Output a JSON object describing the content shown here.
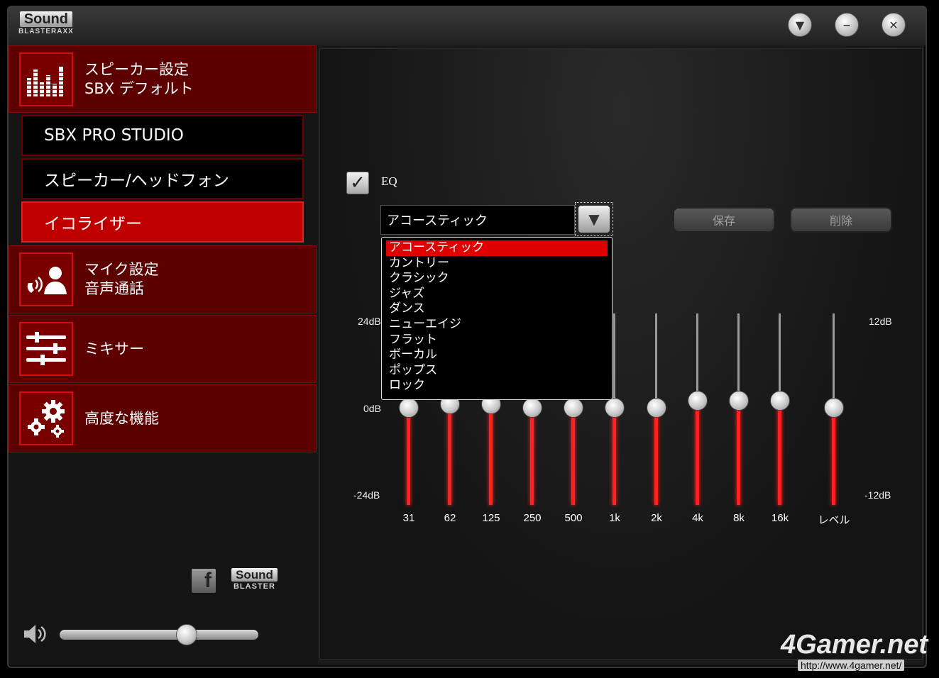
{
  "app": {
    "logo_line1": "Sound",
    "logo_line2": "BLASTERAXX",
    "window_buttons": [
      "dropdown",
      "minimize",
      "close"
    ]
  },
  "sidebar": {
    "categories": [
      {
        "icon": "equalizer-bars-icon",
        "line1": "スピーカー設定",
        "line2": "SBX デフォルト"
      },
      {
        "icon": "voice-chat-icon",
        "line1": "マイク設定",
        "line2": "音声通話"
      },
      {
        "icon": "mixer-sliders-icon",
        "line1": "ミキサー",
        "line2": ""
      },
      {
        "icon": "gears-icon",
        "line1": "高度な機能",
        "line2": ""
      }
    ],
    "subitems": [
      {
        "label": "SBX PRO STUDIO",
        "active": false
      },
      {
        "label": "スピーカー/ヘッドフォン",
        "active": false
      },
      {
        "label": "イコライザー",
        "active": true
      }
    ],
    "footer": {
      "facebook_letter": "f",
      "brand_line1": "Sound",
      "brand_line2": "BLASTER",
      "volume_level": 0.64
    }
  },
  "equalizer": {
    "checkbox_label": "EQ",
    "checked": true,
    "preset_value": "アコースティック",
    "save_label": "保存",
    "delete_label": "削除",
    "left_scale": {
      "top": "24dB",
      "mid": "0dB",
      "bottom": "-24dB"
    },
    "right_scale": {
      "top": "12dB",
      "bottom": "-12dB"
    },
    "bands": [
      {
        "label": "31",
        "level_db": 0
      },
      {
        "label": "62",
        "level_db": 1
      },
      {
        "label": "125",
        "level_db": 1
      },
      {
        "label": "250",
        "level_db": 0
      },
      {
        "label": "500",
        "level_db": 0
      },
      {
        "label": "1k",
        "level_db": 0
      },
      {
        "label": "2k",
        "level_db": 0
      },
      {
        "label": "4k",
        "level_db": 2
      },
      {
        "label": "8k",
        "level_db": 2
      },
      {
        "label": "16k",
        "level_db": 2
      }
    ],
    "level_label": "レベル",
    "level_db": 0,
    "dropdown_options": [
      "アコースティック",
      "カントリー",
      "クラシック",
      "ジャズ",
      "ダンス",
      "ニューエイジ",
      "フラット",
      "ボーカル",
      "ポップス",
      "ロック"
    ],
    "dropdown_selected": "アコースティック"
  },
  "watermark": {
    "brand": "4Gamer.net",
    "url": "http://www.4gamer.net/"
  }
}
